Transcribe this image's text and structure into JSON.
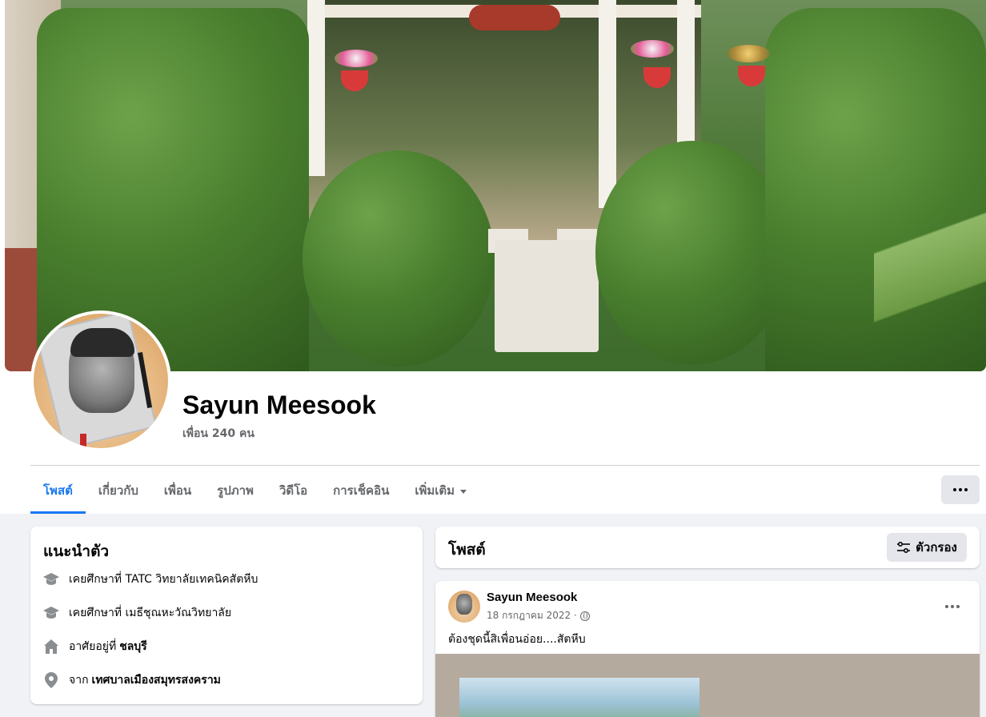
{
  "profile": {
    "name": "Sayun Meesook",
    "friends": "เพื่อน 240 คน"
  },
  "tabs": [
    {
      "label": "โพสต์",
      "active": true
    },
    {
      "label": "เกี่ยวกับ"
    },
    {
      "label": "เพื่อน"
    },
    {
      "label": "รูปภาพ"
    },
    {
      "label": "วิดีโอ"
    },
    {
      "label": "การเช็คอิน"
    },
    {
      "label": "เพิ่มเติม",
      "dropdown": true
    }
  ],
  "intro": {
    "title": "แนะนำตัว",
    "items": [
      {
        "icon": "graduation-cap-icon",
        "prefix": "เคยศึกษาที่",
        "value": "TATC วิทยาลัยเทคนิคสัตหีบ",
        "bold": false
      },
      {
        "icon": "graduation-cap-icon",
        "prefix": "เคยศึกษาที่",
        "value": "เมธีชุณหะวัณวิทยาลัย",
        "bold": false
      },
      {
        "icon": "home-icon",
        "prefix": "อาศัยอยู่ที่",
        "value": "ชลบุรี",
        "bold": true
      },
      {
        "icon": "location-pin-icon",
        "prefix": "จาก",
        "value": "เทศบาลเมืองสมุทรสงคราม",
        "bold": true
      }
    ]
  },
  "posts_header": {
    "title": "โพสต์",
    "filter_label": "ตัวกรอง"
  },
  "post": {
    "author": "Sayun Meesook",
    "date": "18 กรกฎาคม 2022 ·",
    "privacy": "public",
    "text": "ต้องชุดนี้สิเพื่อนอ่อย....สัตหีบ"
  },
  "colors": {
    "accent": "#1877f2",
    "secondary_text": "#65676b",
    "page_bg": "#f0f2f5",
    "button_bg": "#e4e6eb"
  }
}
